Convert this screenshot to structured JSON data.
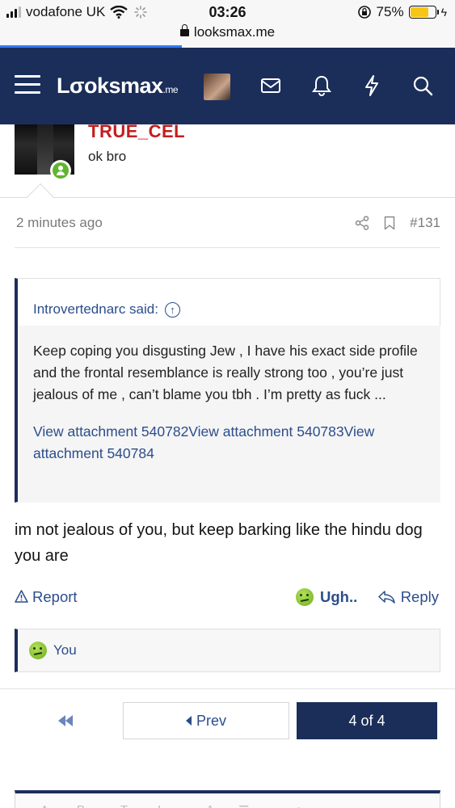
{
  "status_bar": {
    "carrier": "vodafone UK",
    "time": "03:26",
    "battery_percent": "75%",
    "battery_level": 0.75,
    "url": "looksmax.me",
    "page_load_progress": 0.4
  },
  "navbar": {
    "logo_main": "Lσoksmax",
    "logo_suffix": ".me",
    "icons": [
      "menu-icon",
      "avatar",
      "mail-icon",
      "bell-icon",
      "bolt-icon",
      "search-icon"
    ]
  },
  "post": {
    "username": "TRUE_CEL",
    "message": "ok bro"
  },
  "meta": {
    "time": "2 minutes ago",
    "post_number": "#131"
  },
  "quote": {
    "author_line": "Introvertednarc said:",
    "body": "Keep coping you disgusting Jew , I have his exact side profile and the frontal resemblance is really strong too , you’re just jealous of me , can’t blame you tbh . I’m pretty as fuck ...",
    "attachments": "View attachment 540782View attachment 540783View attachment 540784"
  },
  "reply": {
    "text": "im not jealous of you, but keep barking like the hindu dog you are"
  },
  "actions": {
    "report": "Report",
    "reaction": "Ugh..",
    "reply": "Reply"
  },
  "reactions": {
    "who": "You"
  },
  "pagination": {
    "prev": "Prev",
    "current": "4 of 4"
  },
  "colors": {
    "navbar": "#1b2e5a",
    "username": "#c41d1d",
    "link": "#2b4d8c"
  }
}
